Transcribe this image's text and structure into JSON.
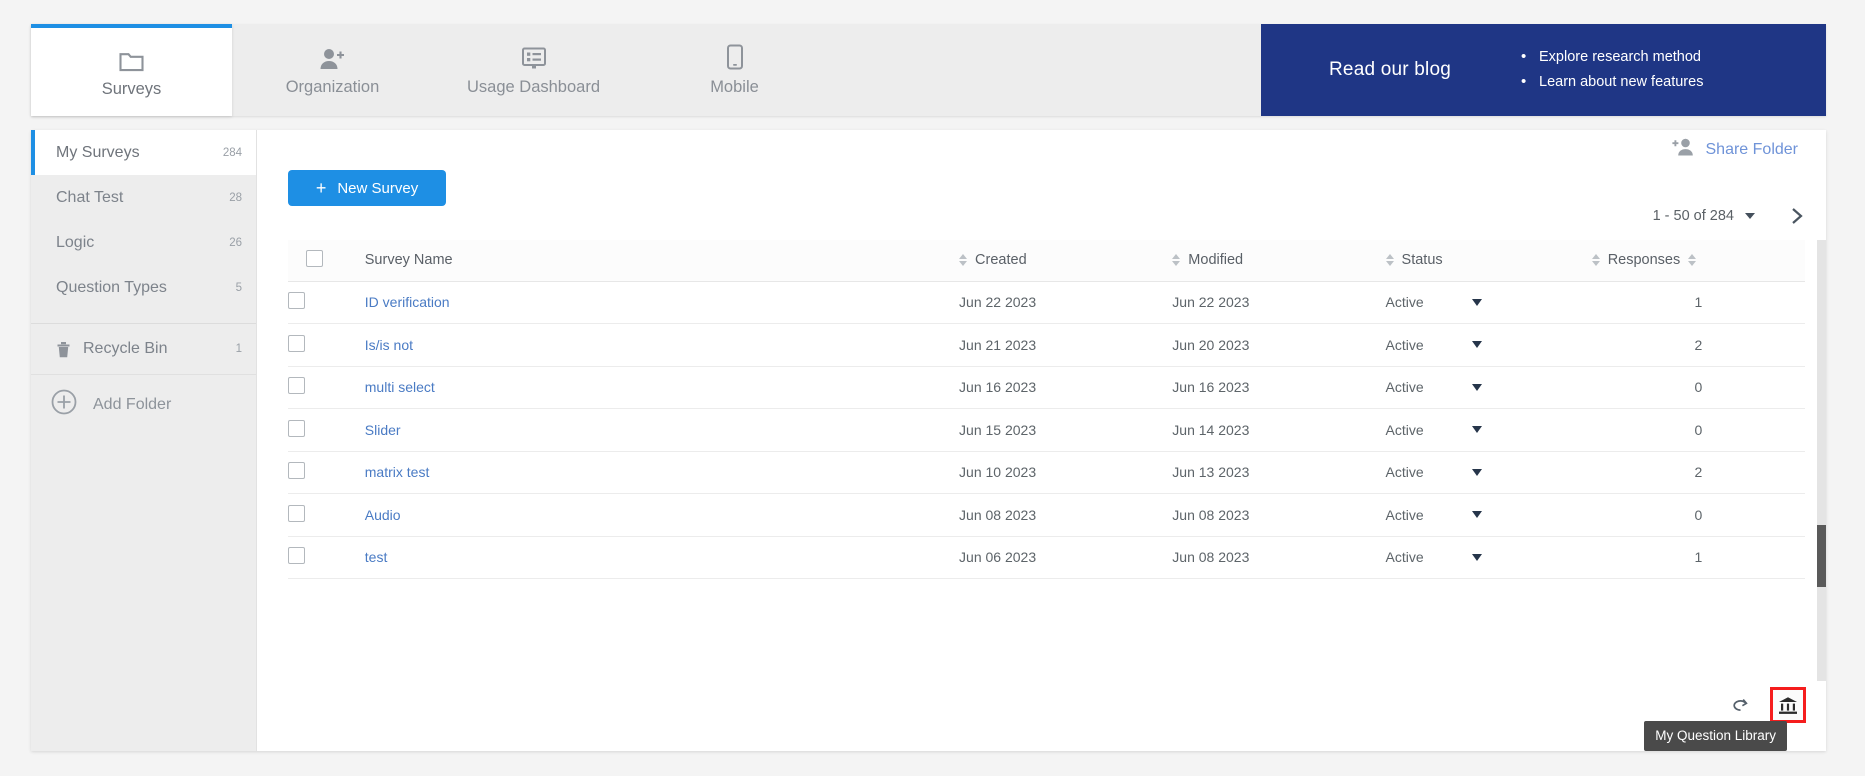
{
  "topnav": {
    "tabs": [
      {
        "label": "Surveys",
        "icon": "folder-icon",
        "active": true
      },
      {
        "label": "Organization",
        "icon": "add-person-icon",
        "active": false
      },
      {
        "label": "Usage Dashboard",
        "icon": "dashboard-monitor-icon",
        "active": false
      },
      {
        "label": "Mobile",
        "icon": "mobile-phone-icon",
        "active": false
      }
    ]
  },
  "promo": {
    "title": "Read our blog",
    "bullets": [
      "Explore research method",
      "Learn about new features"
    ],
    "background": "#1f3685"
  },
  "sidebar": {
    "folders": [
      {
        "label": "My Surveys",
        "count": "284",
        "active": true
      },
      {
        "label": "Chat Test",
        "count": "28",
        "active": false
      },
      {
        "label": "Logic",
        "count": "26",
        "active": false
      },
      {
        "label": "Question Types",
        "count": "5",
        "active": false
      }
    ],
    "recycle_bin": {
      "label": "Recycle Bin",
      "count": "1",
      "icon": "trash-icon"
    },
    "add_folder": {
      "label": "Add Folder",
      "icon": "plus-circle-icon"
    }
  },
  "toolbar": {
    "new_survey_label": "New Survey",
    "new_survey_plus": "+",
    "share_folder_label": "Share Folder",
    "share_folder_icon": "add-person-icon",
    "accent_color": "#1e8fe4"
  },
  "pagination": {
    "range_label": "1 - 50 of 284",
    "dropdown_icon": "chevron-down-icon",
    "next_icon": "chevron-right-icon"
  },
  "table": {
    "columns": [
      {
        "key": "name",
        "label": "Survey Name",
        "sortable": true
      },
      {
        "key": "created",
        "label": "Created",
        "sortable": true
      },
      {
        "key": "modified",
        "label": "Modified",
        "sortable": true
      },
      {
        "key": "status",
        "label": "Status",
        "sortable": true
      },
      {
        "key": "responses",
        "label": "Responses",
        "sortable": true
      }
    ],
    "rows": [
      {
        "name": "ID verification",
        "created": "Jun 22 2023",
        "modified": "Jun 22 2023",
        "status": "Active",
        "responses": "1"
      },
      {
        "name": "Is/is not",
        "created": "Jun 21 2023",
        "modified": "Jun 20 2023",
        "status": "Active",
        "responses": "2"
      },
      {
        "name": "multi select",
        "created": "Jun 16 2023",
        "modified": "Jun 16 2023",
        "status": "Active",
        "responses": "0"
      },
      {
        "name": "Slider",
        "created": "Jun 15 2023",
        "modified": "Jun 14 2023",
        "status": "Active",
        "responses": "0"
      },
      {
        "name": "matrix test",
        "created": "Jun 10 2023",
        "modified": "Jun 13 2023",
        "status": "Active",
        "responses": "2"
      },
      {
        "name": "Audio",
        "created": "Jun 08 2023",
        "modified": "Jun 08 2023",
        "status": "Active",
        "responses": "0"
      },
      {
        "name": "test",
        "created": "Jun 06 2023",
        "modified": "Jun 08 2023",
        "status": "Active",
        "responses": "1"
      }
    ]
  },
  "utility": {
    "feedback_icon": "loop-arrow-icon",
    "question_library_icon": "bank-library-icon",
    "tooltip": "My Question Library",
    "highlight_color": "#f51d1d"
  }
}
